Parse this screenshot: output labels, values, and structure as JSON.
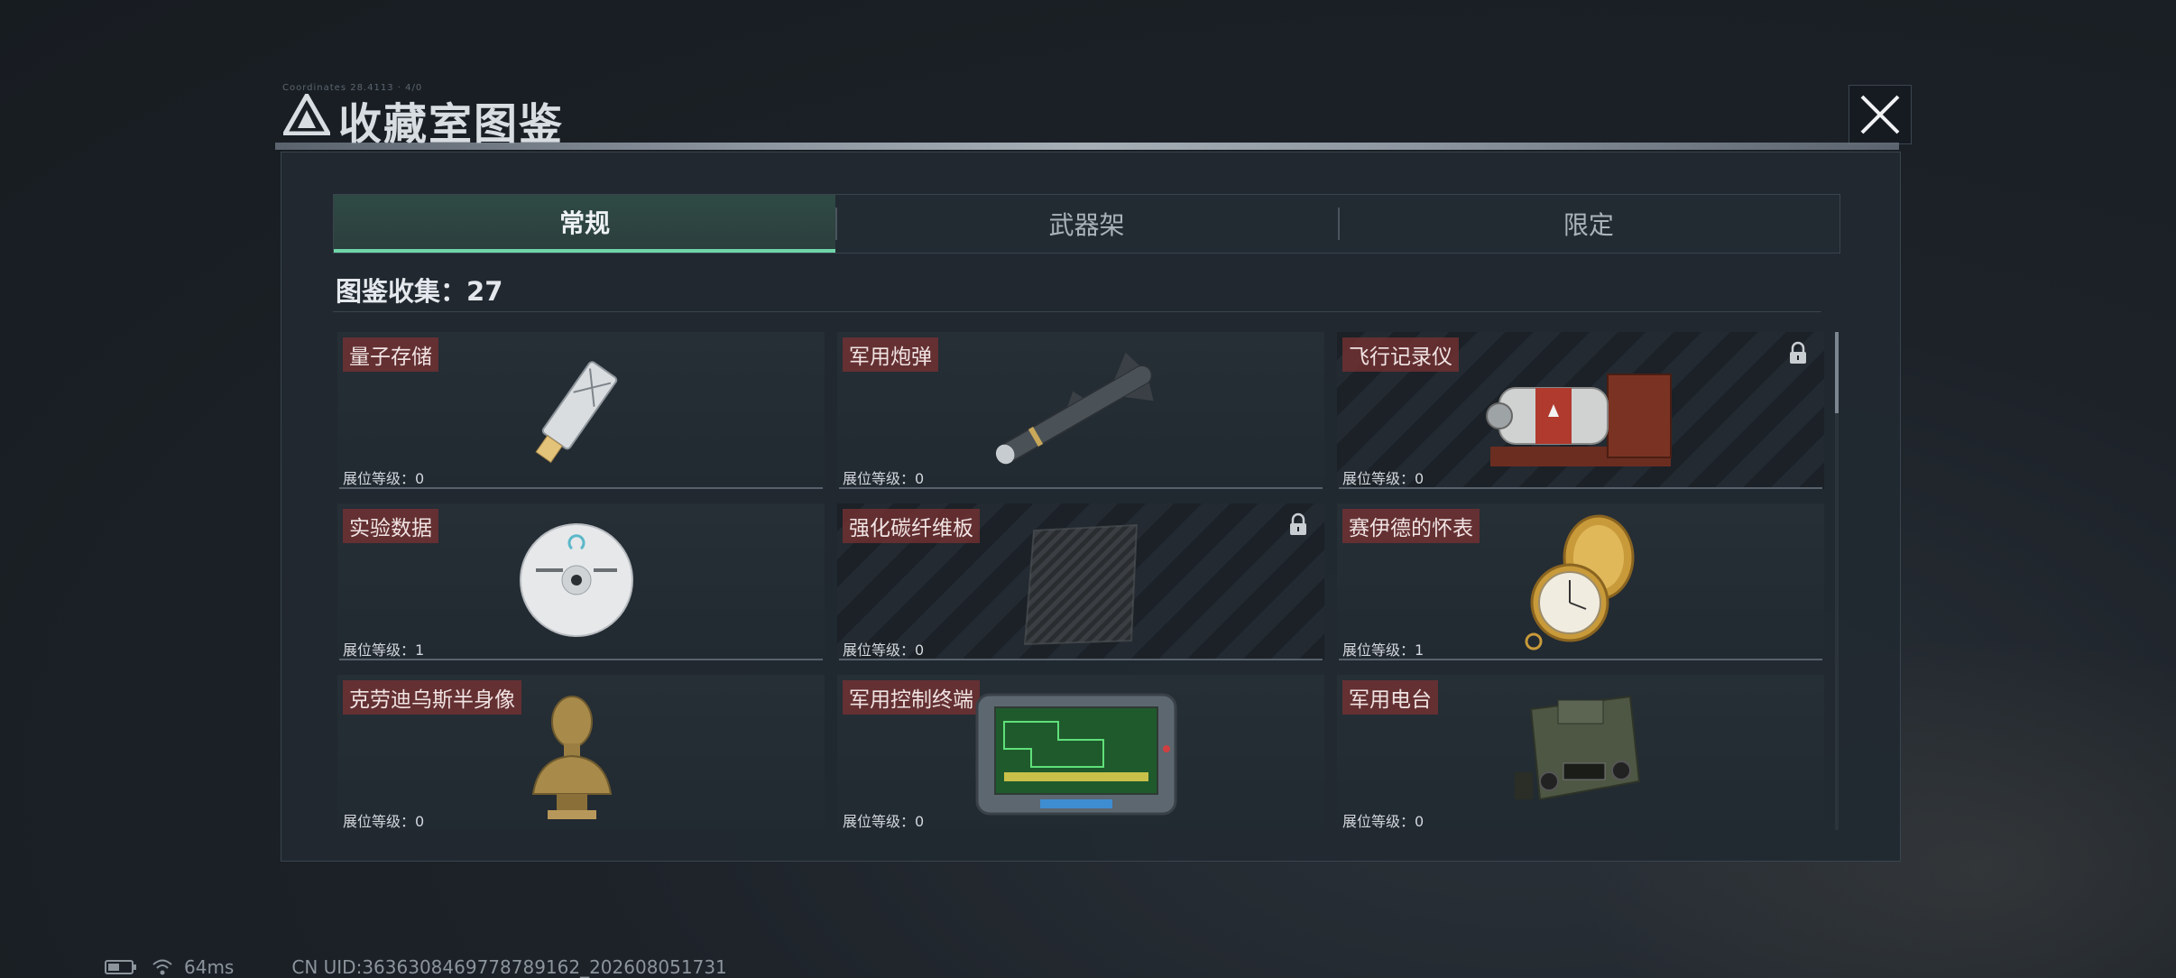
{
  "header": {
    "title": "收藏室图鉴",
    "tiny_text": "Coordinates 28.4113 · 4/0"
  },
  "tabs": [
    {
      "label": "常规",
      "active": true
    },
    {
      "label": "武器架",
      "active": false
    },
    {
      "label": "限定",
      "active": false
    }
  ],
  "collection": {
    "label": "图鉴收集：",
    "count": "27"
  },
  "items": [
    {
      "name": "量子存储",
      "level_label": "展位等级：",
      "level": "0",
      "locked": false,
      "icon": "usb-drive"
    },
    {
      "name": "军用炮弹",
      "level_label": "展位等级：",
      "level": "0",
      "locked": false,
      "icon": "missile"
    },
    {
      "name": "飞行记录仪",
      "level_label": "展位等级：",
      "level": "0",
      "locked": true,
      "icon": "flight-recorder"
    },
    {
      "name": "实验数据",
      "level_label": "展位等级：",
      "level": "1",
      "locked": false,
      "icon": "disc"
    },
    {
      "name": "强化碳纤维板",
      "level_label": "展位等级：",
      "level": "0",
      "locked": true,
      "icon": "carbon-plate"
    },
    {
      "name": "赛伊德的怀表",
      "level_label": "展位等级：",
      "level": "1",
      "locked": false,
      "icon": "pocket-watch"
    },
    {
      "name": "克劳迪乌斯半身像",
      "level_label": "展位等级：",
      "level": "0",
      "locked": false,
      "icon": "bust"
    },
    {
      "name": "军用控制终端",
      "level_label": "展位等级：",
      "level": "0",
      "locked": false,
      "icon": "control-terminal"
    },
    {
      "name": "军用电台",
      "level_label": "展位等级：",
      "level": "0",
      "locked": false,
      "icon": "radio"
    }
  ],
  "status": {
    "ping": "64ms",
    "uid": "CN UID:3636308469778789162_202608051731"
  },
  "colors": {
    "accent": "#6fd5a8",
    "name_tag": "#7d3232",
    "panel": "#222931"
  }
}
